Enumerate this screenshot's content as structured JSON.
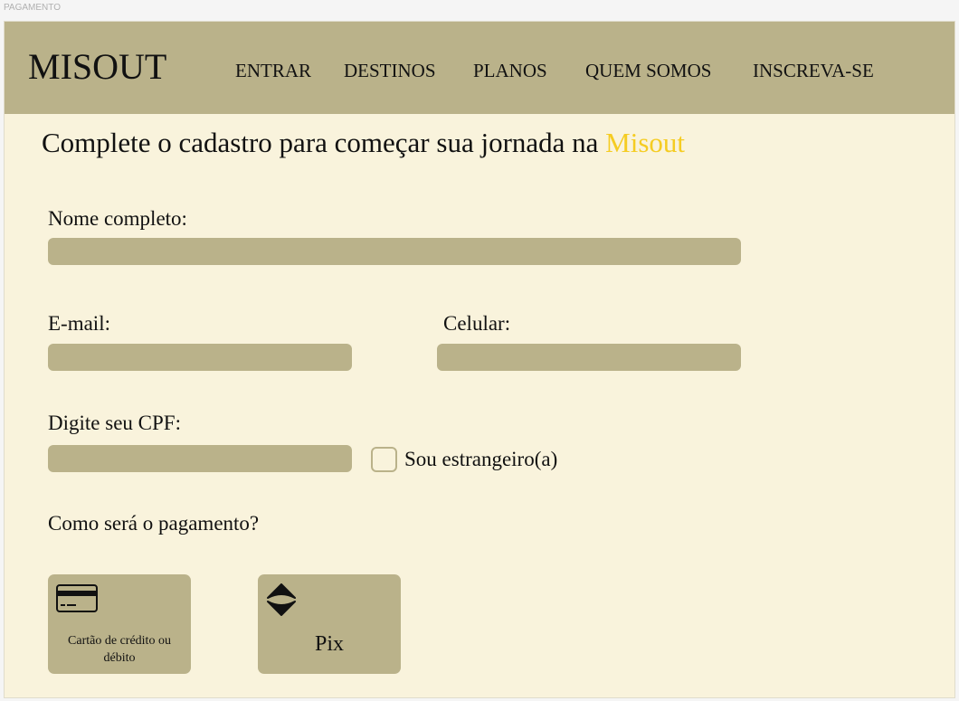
{
  "frame_label": "PAGAMENTO",
  "header": {
    "logo": "MISOUT",
    "nav": [
      "ENTRAR",
      "DESTINOS",
      "PLANOS",
      "QUEM SOMOS",
      "INSCREVA-SE"
    ]
  },
  "title": {
    "text": "Complete o cadastro para começar sua jornada na ",
    "accent": "Misout"
  },
  "form": {
    "name_label": "Nome completo:",
    "name_value": "",
    "email_label": "E-mail:",
    "email_value": "",
    "phone_label": "Celular:",
    "phone_value": "",
    "cpf_label": "Digite seu CPF:",
    "cpf_value": "",
    "foreign_label": "Sou estrangeiro(a)",
    "foreign_checked": false
  },
  "payment": {
    "question": "Como será o pagamento?",
    "options": [
      {
        "label": "Cartão de crédito ou débito",
        "icon": "credit-card-icon"
      },
      {
        "label": "Pix",
        "icon": "pix-icon"
      }
    ]
  },
  "colors": {
    "header": "#bab28a",
    "background": "#f9f3dc",
    "accent": "#f5cc22"
  }
}
